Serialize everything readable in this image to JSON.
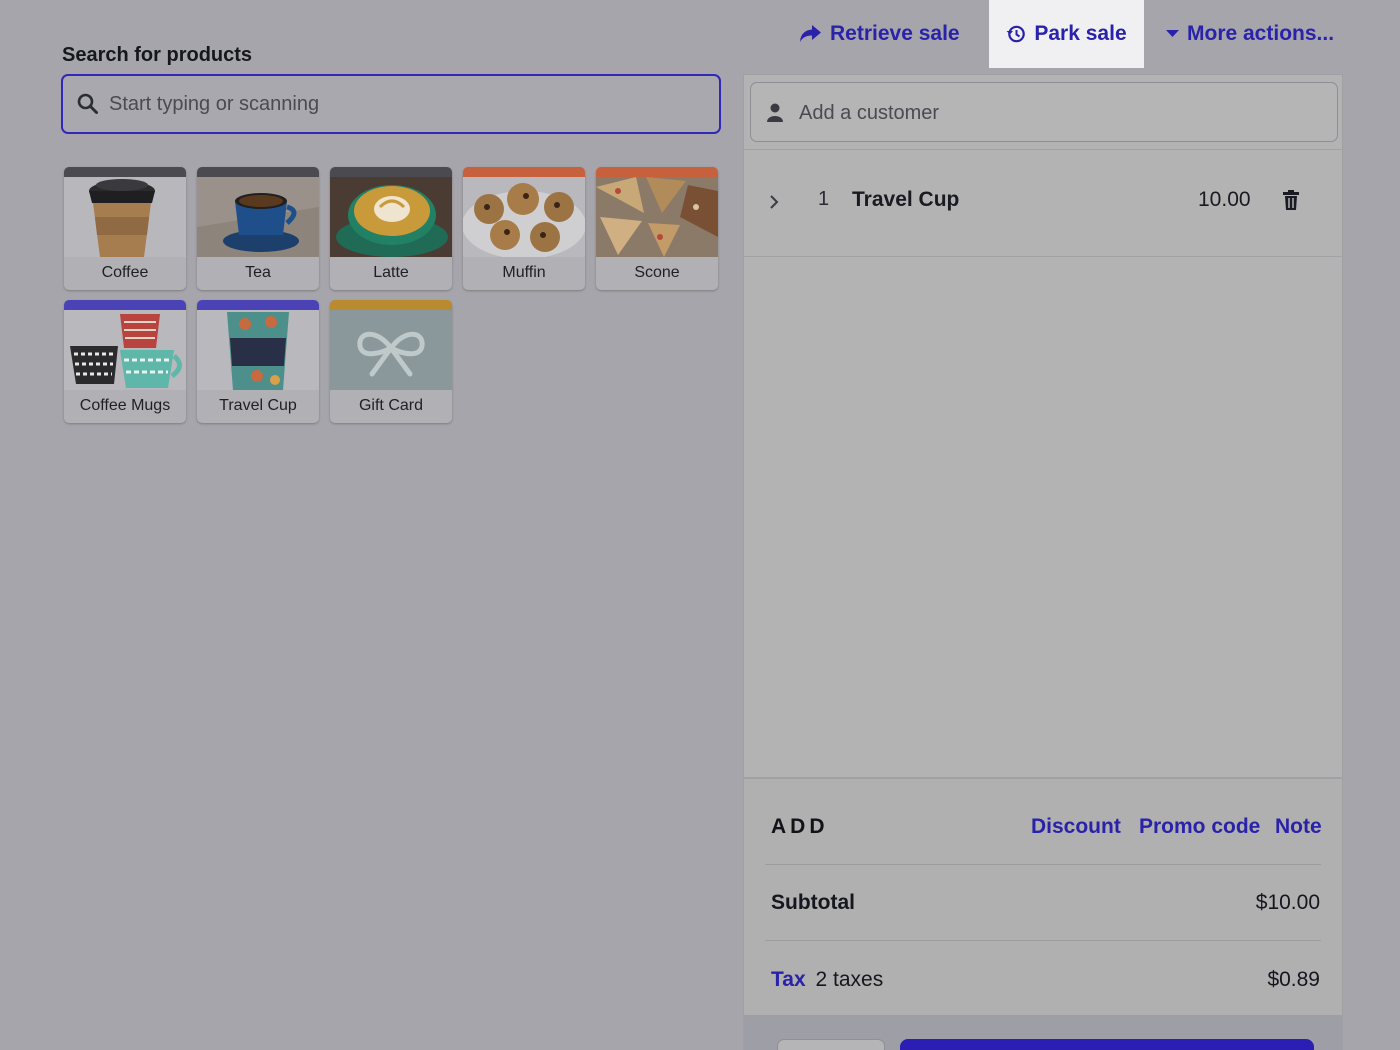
{
  "header": {
    "retrieve_sale": "Retrieve sale",
    "park_sale": "Park sale",
    "more_actions": "More actions..."
  },
  "search": {
    "title": "Search for products",
    "placeholder": "Start typing or scanning"
  },
  "products": [
    {
      "label": "Coffee",
      "color": "#4a4a50",
      "icon": "coffee-cup-image"
    },
    {
      "label": "Tea",
      "color": "#4a4a50",
      "icon": "tea-cup-image"
    },
    {
      "label": "Latte",
      "color": "#4a4a50",
      "icon": "latte-image"
    },
    {
      "label": "Muffin",
      "color": "#c7603c",
      "icon": "muffin-image"
    },
    {
      "label": "Scone",
      "color": "#c7603c",
      "icon": "scone-image"
    },
    {
      "label": "Coffee Mugs",
      "color": "#4b43b5",
      "icon": "mugs-image"
    },
    {
      "label": "Travel Cup",
      "color": "#4b43b5",
      "icon": "travel-cup-image"
    },
    {
      "label": "Gift Card",
      "color": "#b98a2e",
      "icon": "gift-ribbon-icon"
    }
  ],
  "customer": {
    "placeholder": "Add a customer"
  },
  "cart": {
    "items": [
      {
        "qty": "1",
        "name": "Travel Cup",
        "price": "10.00"
      }
    ]
  },
  "totals": {
    "add_label": "ADD",
    "discount": "Discount",
    "promo_code": "Promo code",
    "note": "Note",
    "subtotal_label": "Subtotal",
    "subtotal_value": "$10.00",
    "tax_link": "Tax",
    "tax_detail": "2 taxes",
    "tax_value": "$0.89"
  },
  "colors": {
    "accent": "#2a22a8",
    "pay_button": "#2a1eb5"
  }
}
